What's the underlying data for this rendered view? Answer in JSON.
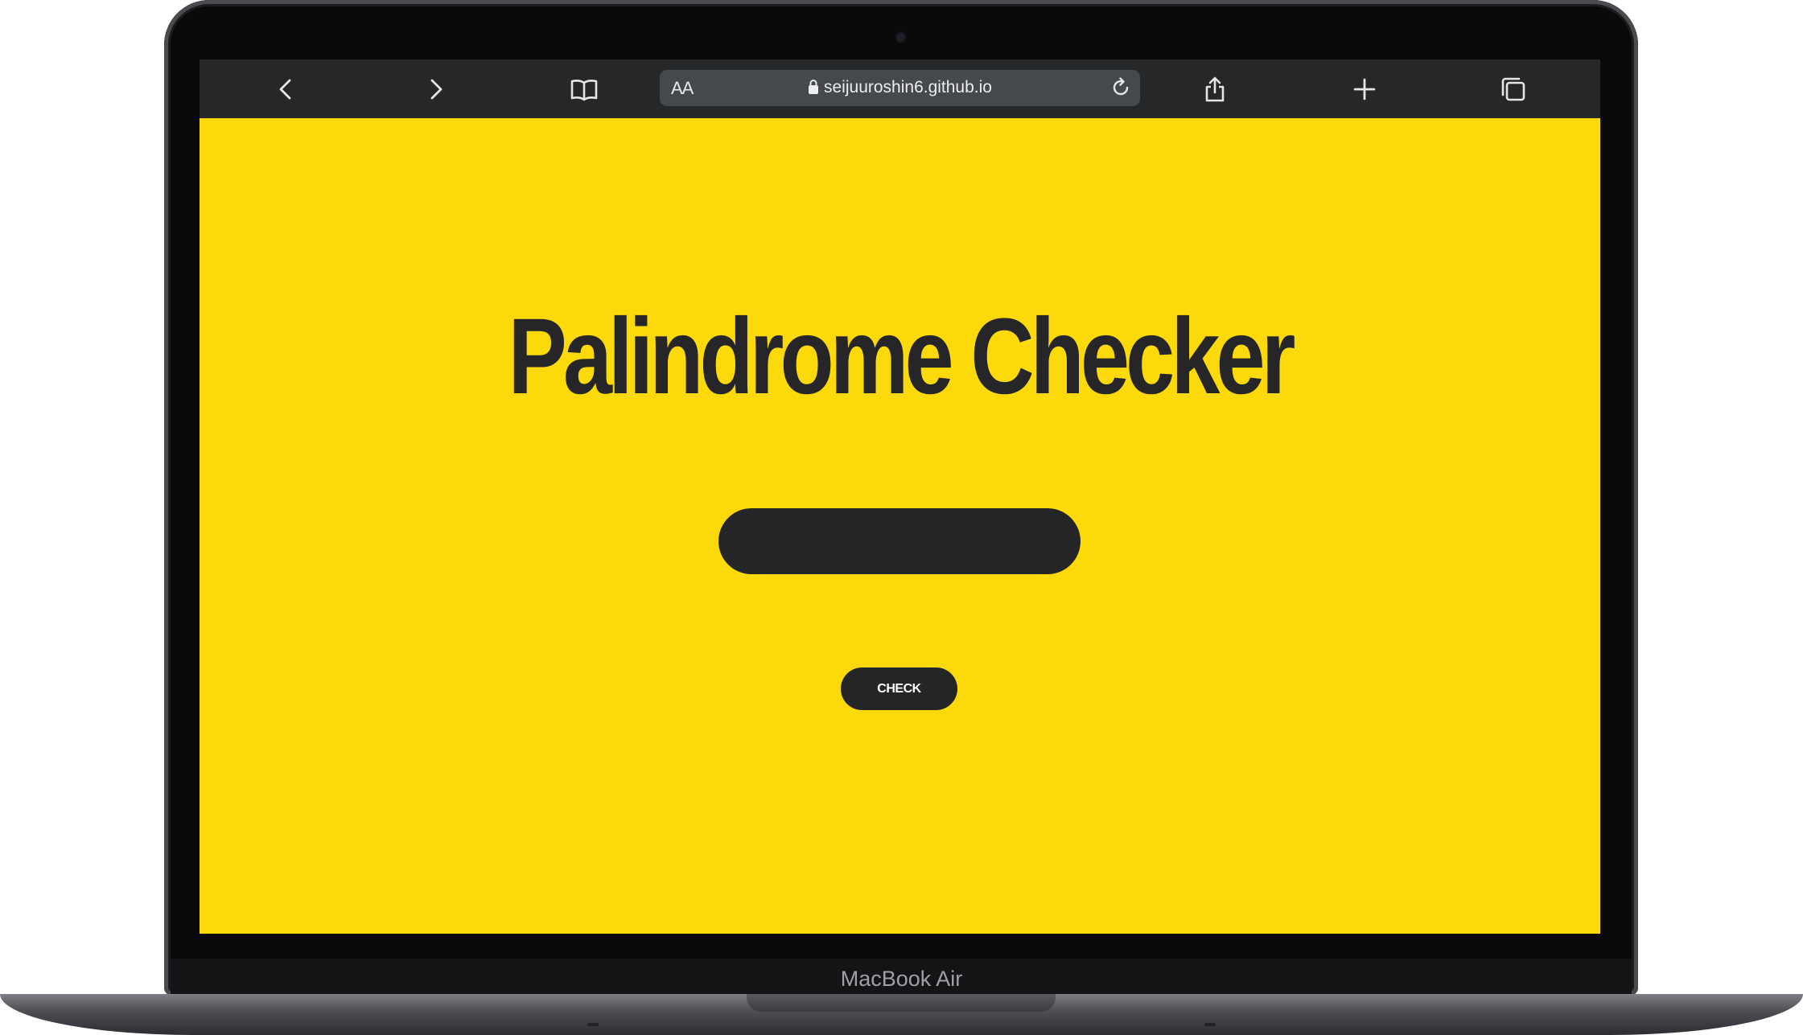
{
  "browser": {
    "reader_label": "AA",
    "url": "seijuuroshin6.github.io"
  },
  "page": {
    "title": "Palindrome Checker",
    "input_value": "",
    "check_label": "CHECK"
  },
  "device": {
    "model_label": "MacBook Air"
  },
  "colors": {
    "page_background": "#fcd90a",
    "dark": "#252527",
    "toolbar": "#252729"
  }
}
